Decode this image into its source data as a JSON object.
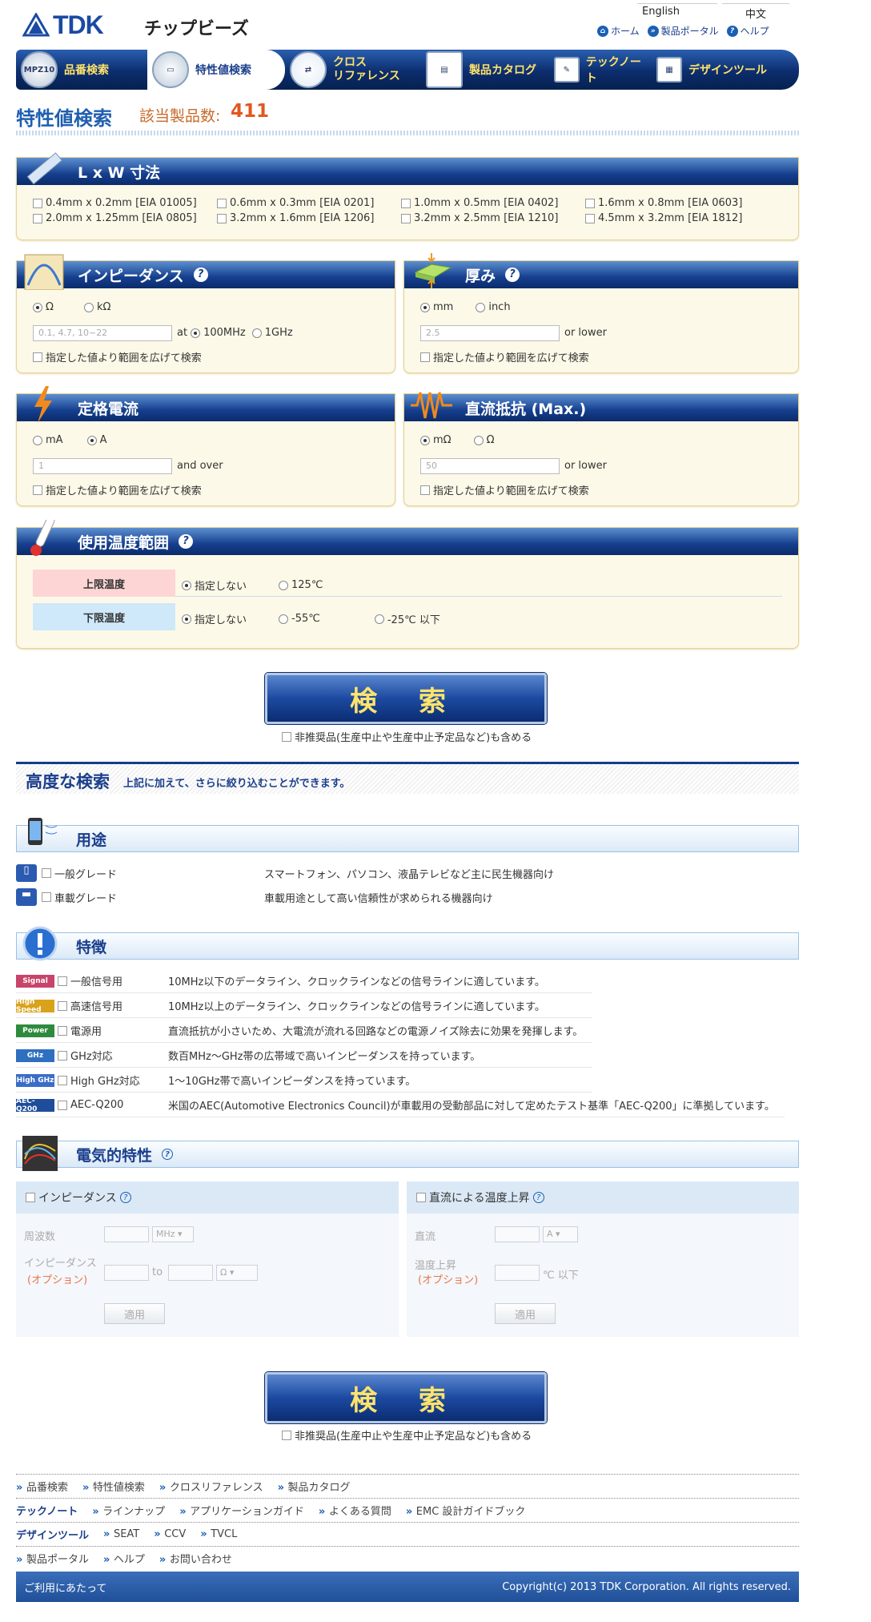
{
  "header": {
    "logo": "TDK",
    "site_title": "チップビーズ",
    "lang_en": "English",
    "lang_zh": "中文",
    "links": [
      {
        "label": "ホーム",
        "icon": "home-icon"
      },
      {
        "label": "製品ポータル",
        "icon": "double-chevron-icon"
      },
      {
        "label": "ヘルプ",
        "icon": "question-icon"
      }
    ]
  },
  "nav": [
    {
      "label": "品番検索",
      "badge": "MPZ10"
    },
    {
      "label": "特性値検索"
    },
    {
      "label": "クロス\nリファレンス"
    },
    {
      "label": "製品カタログ"
    },
    {
      "label": "テックノート"
    },
    {
      "label": "デザインツール"
    }
  ],
  "page": {
    "title": "特性値検索",
    "count_label": "該当製品数:",
    "count": "411"
  },
  "lxw": {
    "title": "L x W 寸法",
    "options": [
      "0.4mm x 0.2mm [EIA 01005]",
      "0.6mm x 0.3mm [EIA 0201]",
      "1.0mm x 0.5mm [EIA 0402]",
      "1.6mm x 0.8mm [EIA 0603]",
      "2.0mm x 1.25mm [EIA 0805]",
      "3.2mm x 1.6mm [EIA 1206]",
      "3.2mm x 2.5mm [EIA 1210]",
      "4.5mm x 3.2mm [EIA 1812]"
    ]
  },
  "impedance": {
    "title": "インピーダンス",
    "unit1": "Ω",
    "unit2": "kΩ",
    "placeholder": "0.1, 4.7, 10~22",
    "at": "at",
    "f1": "100MHz",
    "f2": "1GHz",
    "widen": "指定した値より範囲を広げて検索"
  },
  "thickness": {
    "title": "厚み",
    "unit1": "mm",
    "unit2": "inch",
    "value": "2.5",
    "suffix": "or lower",
    "widen": "指定した値より範囲を広げて検索"
  },
  "current": {
    "title": "定格電流",
    "unit1": "mA",
    "unit2": "A",
    "value": "1",
    "suffix": "and over",
    "widen": "指定した値より範囲を広げて検索"
  },
  "dcr": {
    "title": "直流抵抗 (Max.)",
    "unit1": "mΩ",
    "unit2": "Ω",
    "value": "50",
    "suffix": "or lower",
    "widen": "指定した値より範囲を広げて検索"
  },
  "temp": {
    "title": "使用温度範囲",
    "upper_label": "上限温度",
    "upper_opts": [
      "指定しない",
      "125℃"
    ],
    "lower_label": "下限温度",
    "lower_opts": [
      "指定しない",
      "-55℃",
      "-25℃ 以下"
    ],
    "upper_color": "#fdd5d5",
    "lower_color": "#cfe8fa"
  },
  "search": {
    "label": "検 索",
    "include_obsolete": "非推奨品(生産中止や生産中止予定品など)も含める"
  },
  "advanced": {
    "title": "高度な検索",
    "subtitle": "上記に加えて、さらに絞り込むことができます。"
  },
  "usage": {
    "title": "用途",
    "rows": [
      {
        "label": "一般グレード",
        "desc": "スマートフォン、パソコン、液晶テレビなど主に民生機器向け",
        "icon": "phone-icon"
      },
      {
        "label": "車載グレード",
        "desc": "車載用途として高い信頼性が求められる機器向け",
        "icon": "car-icon"
      }
    ]
  },
  "features": {
    "title": "特徴",
    "rows": [
      {
        "badge": "Signal",
        "color": "#c8446a",
        "label": "一般信号用",
        "desc": "10MHz以下のデータライン、クロックラインなどの信号ラインに適しています。"
      },
      {
        "badge": "High Speed",
        "color": "#d9a21b",
        "label": "高速信号用",
        "desc": "10MHz以上のデータライン、クロックラインなどの信号ラインに適しています。"
      },
      {
        "badge": "Power",
        "color": "#2e8b3e",
        "label": "電源用",
        "desc": "直流抵抗が小さいため、大電流が流れる回路などの電源ノイズ除去に効果を発揮します。"
      },
      {
        "badge": "GHz",
        "color": "#2f6fc0",
        "label": "GHz対応",
        "desc": "数百MHz～GHz帯の広帯域で高いインピーダンスを持っています。"
      },
      {
        "badge": "High GHz",
        "color": "#3b6cc9",
        "label": "High GHz対応",
        "desc": "1～10GHz帯で高いインピーダンスを持っています。"
      },
      {
        "badge": "AEC-Q200",
        "color": "#1e4d9c",
        "label": "AEC-Q200",
        "desc": "米国のAEC(Automotive Electronics Council)が車載用の受動部品に対して定めたテスト基準「AEC-Q200」に準拠しています。"
      }
    ]
  },
  "elec": {
    "title": "電気的特性",
    "left": {
      "title": "インピーダンス",
      "freq_label": "周波数",
      "freq_unit": "MHz",
      "imp_label": "インピーダンス",
      "opt_label": "(オプション)",
      "to": "to",
      "imp_unit": "Ω",
      "apply": "適用"
    },
    "right": {
      "title": "直流による温度上昇",
      "dc_label": "直流",
      "dc_unit": "A",
      "rise_label": "温度上昇",
      "opt_label": "(オプション)",
      "rise_unit": "℃ 以下",
      "apply": "適用"
    }
  },
  "footer": {
    "row1": [
      "品番検索",
      "特性値検索",
      "クロスリファレンス",
      "製品カタログ"
    ],
    "row2_head": "テックノート",
    "row2": [
      "ラインナップ",
      "アプリケーションガイド",
      "よくある質問",
      "EMC 設計ガイドブック"
    ],
    "row3_head": "デザインツール",
    "row3": [
      "SEAT",
      "CCV",
      "TVCL"
    ],
    "row4": [
      "製品ポータル",
      "ヘルプ",
      "お問い合わせ"
    ],
    "terms": "ご利用にあたって",
    "copyright": "Copyright(c) 2013 TDK Corporation. All rights reserved."
  }
}
